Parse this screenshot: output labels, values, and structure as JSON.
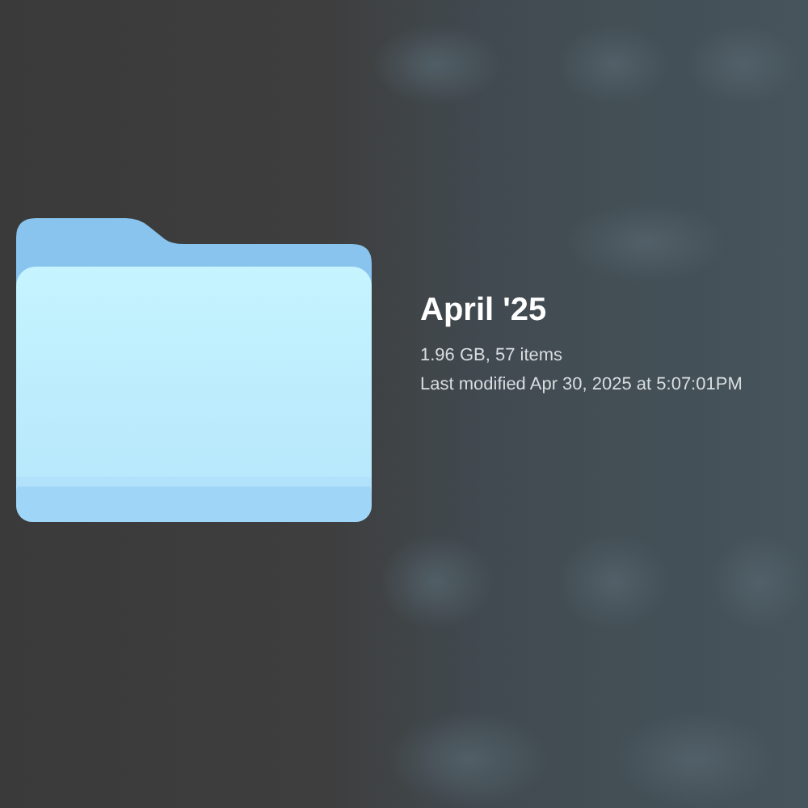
{
  "item": {
    "name": "April '25",
    "size_info": "1.96 GB, 57 items",
    "modified": "Last modified Apr 30, 2025 at 5:07:01PM"
  }
}
